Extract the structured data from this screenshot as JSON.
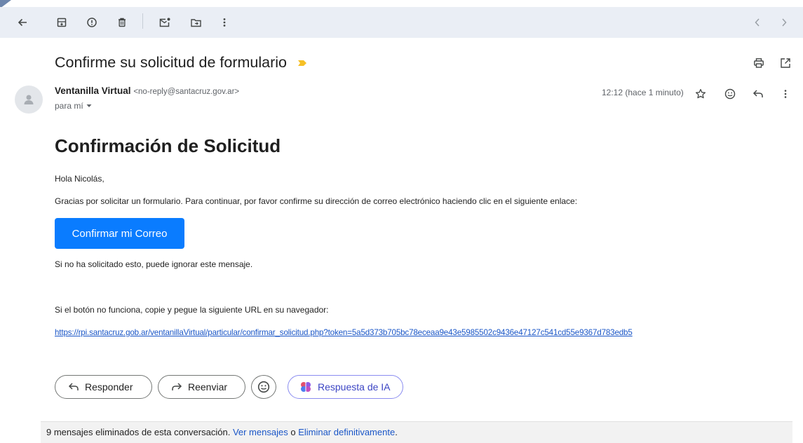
{
  "toolbar": {
    "icons": [
      "back-arrow-icon",
      "archive-icon",
      "report-spam-icon",
      "delete-icon",
      "mark-unread-icon",
      "move-to-icon",
      "more-vertical-icon",
      "prev-chevron-icon",
      "next-chevron-icon"
    ]
  },
  "email": {
    "subject": "Confirme su solicitud de formulario",
    "sender_name": "Ventanilla Virtual",
    "sender_email": "<no-reply@santacruz.gov.ar>",
    "to_label": "para mí",
    "time": "12:12 (hace 1 minuto)",
    "heading": "Confirmación de Solicitud",
    "greeting": "Hola Nicolás,",
    "paragraph1": "Gracias por solicitar un formulario. Para continuar, por favor confirme su dirección de correo electrónico haciendo clic en el siguiente enlace:",
    "confirm_button": "Confirmar mi Correo",
    "ignore_text": "Si no ha solicitado esto, puede ignorar este mensaje.",
    "fallback_text": "Si el botón no funciona, copie y pegue la siguiente URL en su navegador:",
    "confirm_url": "https://rpi.santacruz.gob.ar/ventanillaVirtual/particular/confirmar_solicitud.php?token=5a5d373b705bc78eceaa9e43e5985502c9436e47127c541cd55e9367d783edb5"
  },
  "actions": {
    "reply": "Responder",
    "forward": "Reenviar",
    "ai_reply": "Respuesta de IA"
  },
  "footer": {
    "deleted_text": "9 mensajes eliminados de esta conversación.",
    "view_link": "Ver mensajes",
    "or_text": "o",
    "delete_link": "Eliminar definitivamente",
    "period": "."
  },
  "colors": {
    "toolbar_bg": "#eaeef5",
    "button_blue": "#0a7cff",
    "link_blue": "#1a56c7",
    "important_marker": "#f6c026"
  }
}
